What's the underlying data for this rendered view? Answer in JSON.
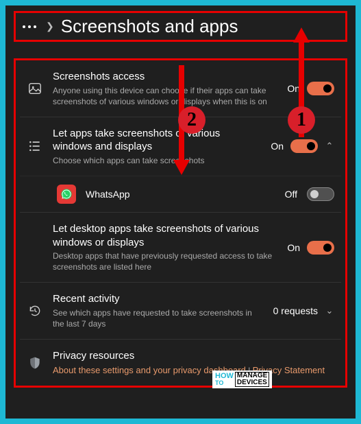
{
  "header": {
    "title": "Screenshots and apps"
  },
  "rows": {
    "access": {
      "title": "Screenshots access",
      "sub": "Anyone using this device can choose if their apps can take screenshots of various windows or displays when this is on",
      "state": "On"
    },
    "apps": {
      "title": "Let apps take screenshots of various windows and displays",
      "sub": "Choose which apps can take screenshots",
      "state": "On"
    },
    "whatsapp": {
      "name": "WhatsApp",
      "state": "Off"
    },
    "desktop": {
      "title": "Let desktop apps take screenshots of various windows or displays",
      "sub": "Desktop apps that have previously requested access to take screenshots are listed here",
      "state": "On"
    },
    "recent": {
      "title": "Recent activity",
      "sub": "See which apps have requested to take screenshots in the last 7 days",
      "count": "0 requests"
    },
    "privacy": {
      "title": "Privacy resources",
      "link1": "About these settings and your privacy dashboard",
      "link2": "Privacy Statement"
    }
  },
  "annotations": {
    "badge1": "1",
    "badge2": "2"
  },
  "watermark": {
    "how": "HOW",
    "to": "TO",
    "manage": "MANAGE",
    "devices": "DEVICES"
  }
}
